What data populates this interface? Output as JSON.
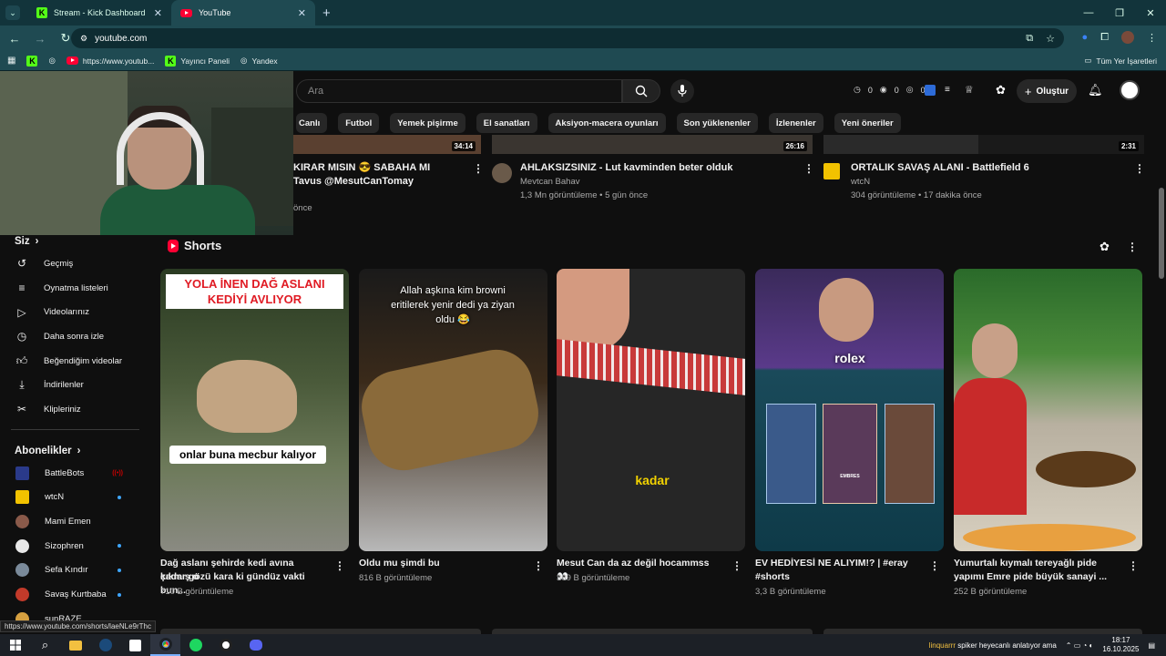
{
  "browser": {
    "tabs": [
      {
        "label": "Stream - Kick Dashboard",
        "icon": "kick-icon"
      },
      {
        "label": "YouTube",
        "icon": "youtube-icon"
      }
    ],
    "url": "youtube.com",
    "bookmarks": [
      {
        "label": "https://www.youtub...",
        "icon": "youtube-icon"
      },
      {
        "label": "Yayıncı Paneli",
        "icon": "kick-icon"
      },
      {
        "label": "Yandex",
        "icon": "globe-icon"
      }
    ],
    "all_bookmarks": "Tüm Yer İşaretleri"
  },
  "youtube": {
    "search_placeholder": "Ara",
    "header_stats": [
      "0",
      "0",
      "0"
    ],
    "create_label": "Oluştur",
    "chips": [
      "Canlı",
      "Futbol",
      "Yemek pişirme",
      "El sanatları",
      "Aksiyon-macera oyunları",
      "Son yüklenenler",
      "İzlenenler",
      "Yeni öneriler"
    ],
    "top_videos": [
      {
        "title1": "KIRAR MISIN 😎 SABAHA MI",
        "title2": "Tavus @MesutCanTomay",
        "meta": "önce",
        "duration": "34:14"
      },
      {
        "title1": "AHLAKSIZSINIZ - Lut kavminden beter olduk",
        "channel": "Mevtcan Bahav",
        "meta": "1,3 Mn görüntüleme • 5 gün önce",
        "duration": "26:16"
      },
      {
        "title1": "ORTALIK SAVAŞ ALANI - Battlefield 6",
        "channel": "wtcN",
        "meta": "304 görüntüleme • 17 dakika önce",
        "duration": "2:31"
      }
    ],
    "sidebar": {
      "you_label": "Siz",
      "you_items": [
        {
          "label": "Geçmiş",
          "icon": "history-icon"
        },
        {
          "label": "Oynatma listeleri",
          "icon": "playlist-icon"
        },
        {
          "label": "Videolarınız",
          "icon": "your-videos-icon"
        },
        {
          "label": "Daha sonra izle",
          "icon": "clock-icon"
        },
        {
          "label": "Beğendiğim videolar",
          "icon": "thumbs-up-icon"
        },
        {
          "label": "İndirilenler",
          "icon": "download-icon"
        },
        {
          "label": "Klipleriniz",
          "icon": "scissors-icon"
        }
      ],
      "subs_label": "Abonelikler",
      "subs": [
        {
          "label": "BattleBots",
          "color": "#2a3a8a",
          "status": "live"
        },
        {
          "label": "wtcN",
          "color": "#f2c200",
          "status": "dot"
        },
        {
          "label": "Mami Emen",
          "color": "#8a5a4a",
          "status": ""
        },
        {
          "label": "Sizophren",
          "color": "#e8e8e8",
          "status": "dot"
        },
        {
          "label": "Sefa Kındır",
          "color": "#7a8a9a",
          "status": "dot"
        },
        {
          "label": "Savaş Kurtbaba",
          "color": "#c23a2a",
          "status": "dot"
        },
        {
          "label": "sunRAZE",
          "color": "#d6a040",
          "status": ""
        }
      ]
    },
    "shorts_label": "Shorts",
    "shorts": [
      {
        "title1": "Dağ aslanı şehirde kedi avına çıkmış o",
        "title2": "kadar gözü kara ki gündüz vakti bun...",
        "views": "710 B görüntüleme",
        "overlay_top": "YOLA İNEN DAĞ ASLANI KEDİYİ AVLIYOR",
        "overlay_bottom": "onlar buna mecbur kalıyor"
      },
      {
        "title1": "Oldu mu şimdi bu",
        "title2": "",
        "views": "816 B görüntüleme",
        "overlay_top": "Allah aşkına kim browni eritilerek yenir dedi ya ziyan oldu 😂",
        "overlay_bottom": ""
      },
      {
        "title1": "Mesut Can da az değil hocammss 👀",
        "title2": "",
        "views": "369 B görüntüleme",
        "overlay_top": "",
        "overlay_bottom": "kadar"
      },
      {
        "title1": "EV HEDİYESİ NE ALIYIM!? | #eray",
        "title2": "#shorts",
        "views": "3,3 B görüntüleme",
        "overlay_top": "rolex",
        "overlay_bottom": "EMBRES"
      },
      {
        "title1": "Yumurtalı kıymalı tereyağlı pide",
        "title2": "yapımı Emre pide büyük sanayi ...",
        "views": "252 B görüntüleme",
        "overlay_top": "",
        "overlay_bottom": ""
      }
    ],
    "status_url": "https://www.youtube.com/shorts/laeNLe9rThc"
  },
  "taskbar": {
    "now_playing_user": "linquarrr",
    "now_playing_text": "spiker heyecanlı anlatıyor ama",
    "time": "18:17",
    "date": "16.10.2025"
  },
  "colors": {
    "tab_bg": "#12343b",
    "toolbar_bg": "#1f4a52",
    "youtube_bg": "#0f0f0f",
    "youtube_red": "#ff0033",
    "kick_green": "#53fc18"
  }
}
